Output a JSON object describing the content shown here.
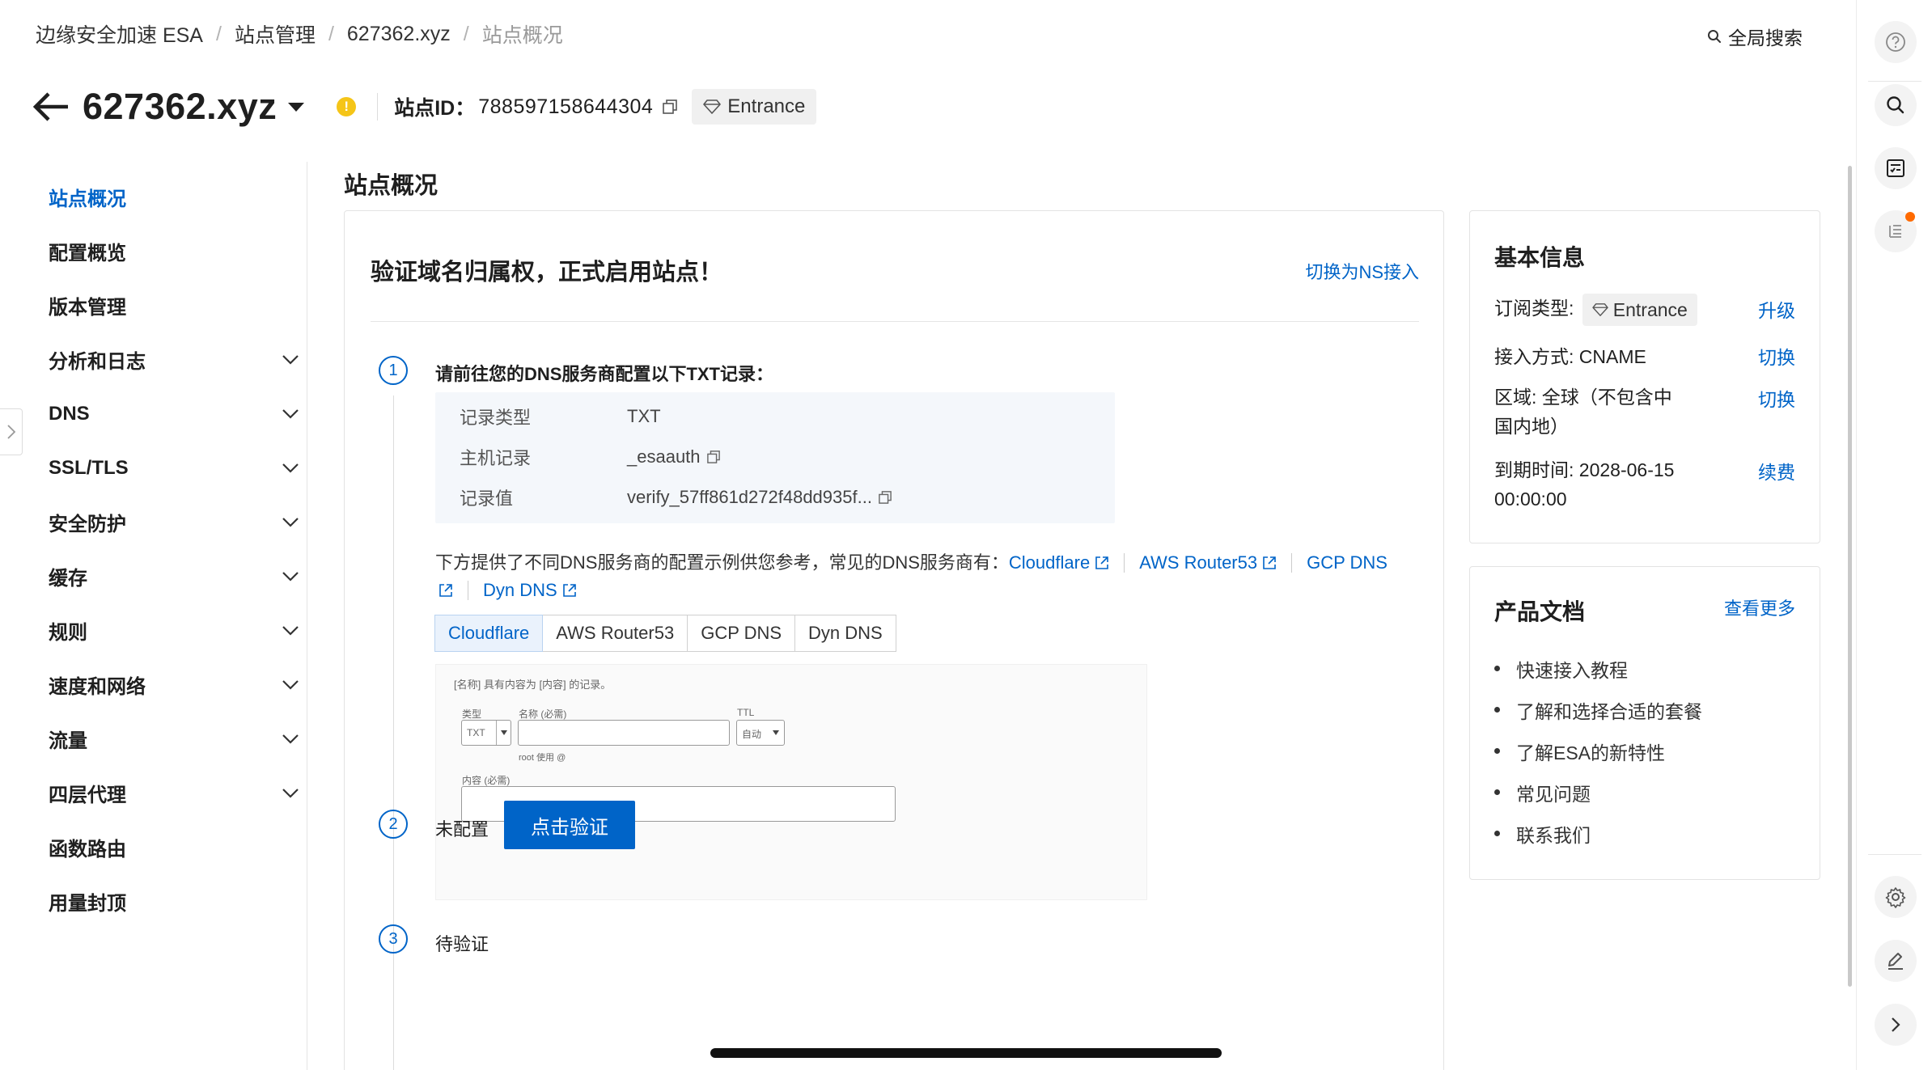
{
  "breadcrumb": [
    "边缘安全加速 ESA",
    "站点管理",
    "627362.xyz",
    "站点概况"
  ],
  "global_search_label": "全局搜索",
  "site": {
    "name": "627362.xyz",
    "warning_symbol": "!",
    "id_label": "站点ID：",
    "id_value": "788597158644304",
    "plan": "Entrance"
  },
  "nav": [
    {
      "label": "站点概况",
      "active": true,
      "expandable": false
    },
    {
      "label": "配置概览",
      "expandable": false
    },
    {
      "label": "版本管理",
      "expandable": false
    },
    {
      "label": "分析和日志",
      "expandable": true
    },
    {
      "label": "DNS",
      "expandable": true
    },
    {
      "label": "SSL/TLS",
      "expandable": true
    },
    {
      "label": "安全防护",
      "expandable": true
    },
    {
      "label": "缓存",
      "expandable": true
    },
    {
      "label": "规则",
      "expandable": true
    },
    {
      "label": "速度和网络",
      "expandable": true
    },
    {
      "label": "流量",
      "expandable": true
    },
    {
      "label": "四层代理",
      "expandable": true
    },
    {
      "label": "函数路由",
      "expandable": false
    },
    {
      "label": "用量封顶",
      "expandable": false
    }
  ],
  "main": {
    "heading": "站点概况",
    "card_title": "验证域名归属权，正式启用站点！",
    "switch_link": "切换为NS接入",
    "steps": [
      {
        "number": "1",
        "text": "请前往您的DNS服务商配置以下TXT记录："
      },
      {
        "number": "2",
        "text": "未配置",
        "button": "点击验证"
      },
      {
        "number": "3",
        "text": "待验证"
      }
    ],
    "records": [
      {
        "key": "记录类型",
        "value": "TXT",
        "copy": false
      },
      {
        "key": "主机记录",
        "value": "_esaauth",
        "copy": true
      },
      {
        "key": "记录值",
        "value": "verify_57ff861d272f48dd935f...",
        "copy": true
      }
    ],
    "provider_intro": "下方提供了不同DNS服务商的配置示例供您参考，常见的DNS服务商有：",
    "providers": [
      "Cloudflare",
      "AWS Router53",
      "GCP DNS",
      "Dyn DNS"
    ],
    "tabs": [
      "Cloudflare",
      "AWS Router53",
      "GCP DNS",
      "Dyn DNS"
    ],
    "active_tab": "Cloudflare",
    "example": {
      "caption": "[名称] 具有内容为 [内容] 的记录。",
      "type_label": "类型",
      "type_value": "TXT",
      "name_label": "名称 (必需)",
      "name_hint": "root 使用 @",
      "ttl_label": "TTL",
      "ttl_value": "自动",
      "content_label": "内容 (必需)"
    }
  },
  "basic_info": {
    "title": "基本信息",
    "subscription_label": "订阅类型:",
    "subscription_value": "Entrance",
    "upgrade": "升级",
    "access": "接入方式: CNAME",
    "access_action": "切换",
    "region": "区域: 全球（不包含中国内地）",
    "region_action": "切换",
    "expire": "到期时间: 2028-06-15 00:00:00",
    "expire_action": "续费"
  },
  "docs": {
    "title": "产品文档",
    "more": "查看更多",
    "items": [
      "快速接入教程",
      "了解和选择合适的套餐",
      "了解ESA的新特性",
      "常见问题",
      "联系我们"
    ]
  },
  "colors": {
    "accent": "#0064c8",
    "warning": "#f5c518",
    "notify": "#ff6a00"
  },
  "rail_icons": [
    "help-icon",
    "search-icon",
    "checklist-icon",
    "notes-icon",
    "settings-icon",
    "edit-icon",
    "chevron-right-icon"
  ]
}
